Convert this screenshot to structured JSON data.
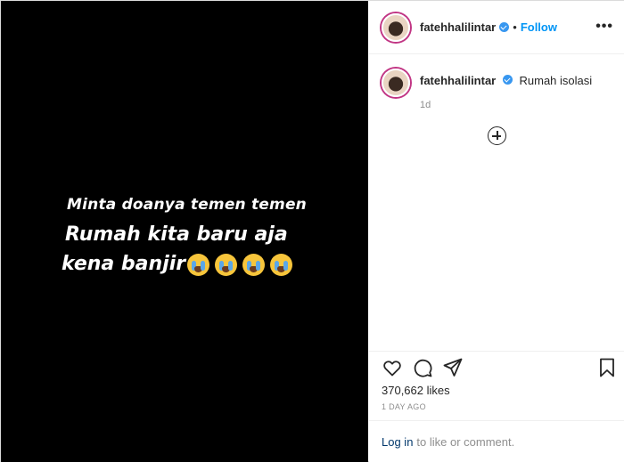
{
  "media": {
    "caption_lines": [
      "Minta doanya temen temen",
      "Rumah kita baru aja",
      "kena banjir"
    ],
    "emojis": [
      "crying-face",
      "crying-face",
      "crying-face",
      "crying-face"
    ]
  },
  "header": {
    "username": "fatehhalilintar",
    "separator": "•",
    "follow_label": "Follow",
    "more_label": "•••"
  },
  "comment": {
    "username": "fatehhalilintar",
    "text": "Rumah isolasi",
    "time": "1d"
  },
  "actions": {
    "icons": [
      "heart-icon",
      "comment-icon",
      "share-icon",
      "bookmark-icon"
    ],
    "likes": "370,662 likes",
    "posted": "1 DAY AGO"
  },
  "footer": {
    "login_label": "Log in",
    "rest": "to like or comment."
  },
  "colors": {
    "accent": "#0095f6",
    "verified": "#3897f0",
    "muted": "#8e8e8e"
  }
}
